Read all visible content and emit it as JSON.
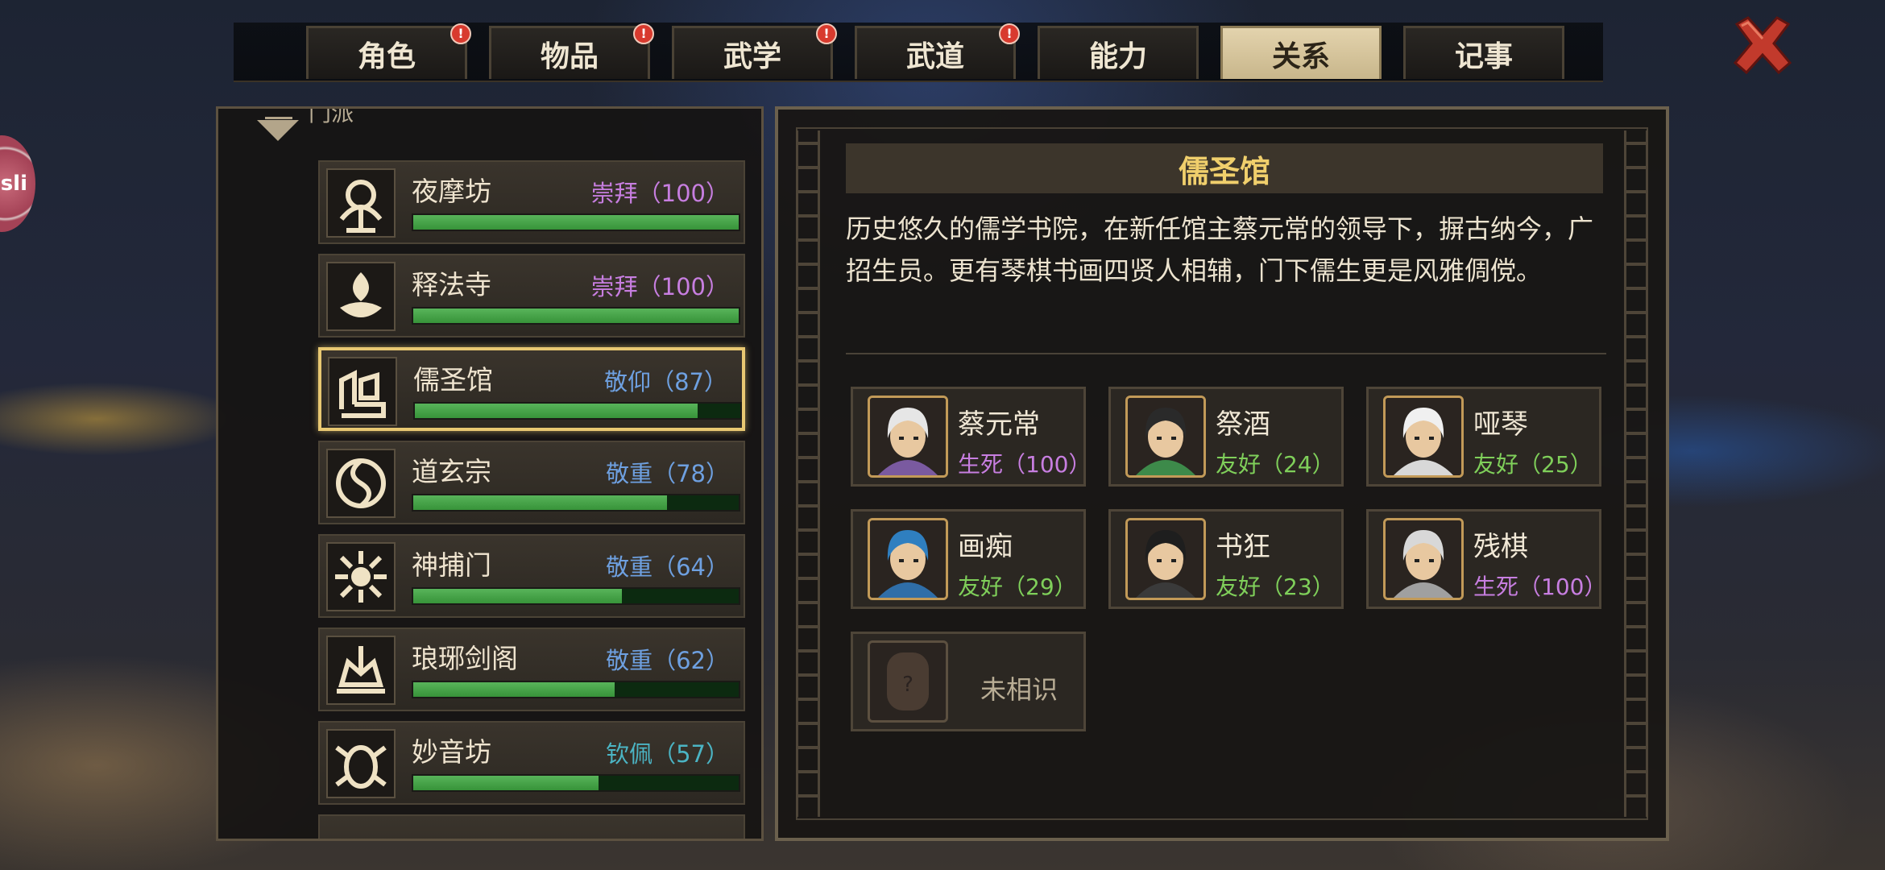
{
  "tabs": [
    {
      "label": "角色",
      "badge": "!"
    },
    {
      "label": "物品",
      "badge": "!"
    },
    {
      "label": "武学",
      "badge": "!"
    },
    {
      "label": "武道",
      "badge": "!"
    },
    {
      "label": "能力",
      "badge": ""
    },
    {
      "label": "关系",
      "badge": "",
      "active": true
    },
    {
      "label": "记事",
      "badge": ""
    }
  ],
  "left_edge_badge": "sli",
  "group_label": "门派",
  "sects": [
    {
      "name": "夜摩坊",
      "relation": "崇拜（100）",
      "level": 1.0,
      "color": "#c77ee0"
    },
    {
      "name": "释法寺",
      "relation": "崇拜（100）",
      "level": 1.0,
      "color": "#c77ee0"
    },
    {
      "name": "儒圣馆",
      "relation": "敬仰（87）",
      "level": 0.87,
      "color": "#6ea0e0",
      "selected": true
    },
    {
      "name": "道玄宗",
      "relation": "敬重（78）",
      "level": 0.78,
      "color": "#6ea0e0"
    },
    {
      "name": "神捕门",
      "relation": "敬重（64）",
      "level": 0.64,
      "color": "#6ea0e0"
    },
    {
      "name": "琅琊剑阁",
      "relation": "敬重（62）",
      "level": 0.62,
      "color": "#6ea0e0"
    },
    {
      "name": "妙音坊",
      "relation": "钦佩（57）",
      "level": 0.57,
      "color": "#4bb4c4"
    }
  ],
  "detail": {
    "title": "儒圣馆",
    "description": "历史悠久的儒学书院，在新任馆主蔡元常的领导下，摒古纳今，广招生员。更有琴棋书画四贤人相辅，门下儒生更是风雅倜傥。",
    "npcs": [
      {
        "name": "蔡元常",
        "relation": "生死（100）",
        "color": "#c77ee0",
        "hair": "#e6e6e6",
        "robe": "#7a5aa0"
      },
      {
        "name": "祭酒",
        "relation": "友好（24）",
        "color": "#7fcf5a",
        "hair": "#2a2a2a",
        "robe": "#3d8a4a"
      },
      {
        "name": "哑琴",
        "relation": "友好（25）",
        "color": "#7fcf5a",
        "hair": "#f0f0f0",
        "robe": "#d8d8d8"
      },
      {
        "name": "画痴",
        "relation": "友好（29）",
        "color": "#7fcf5a",
        "hair": "#2f7fc0",
        "robe": "#2f6ea8"
      },
      {
        "name": "书狂",
        "relation": "友好（23）",
        "color": "#7fcf5a",
        "hair": "#1e1e1e",
        "robe": "#3a3a3a"
      },
      {
        "name": "残棋",
        "relation": "生死（100）",
        "color": "#c77ee0",
        "hair": "#d8d8d8",
        "robe": "#a0a0a0"
      }
    ],
    "unknown": {
      "label": "未相识",
      "icon": "?"
    }
  },
  "icons": {
    "close": "close-x-icon",
    "collapse": "triangle-down-icon"
  }
}
